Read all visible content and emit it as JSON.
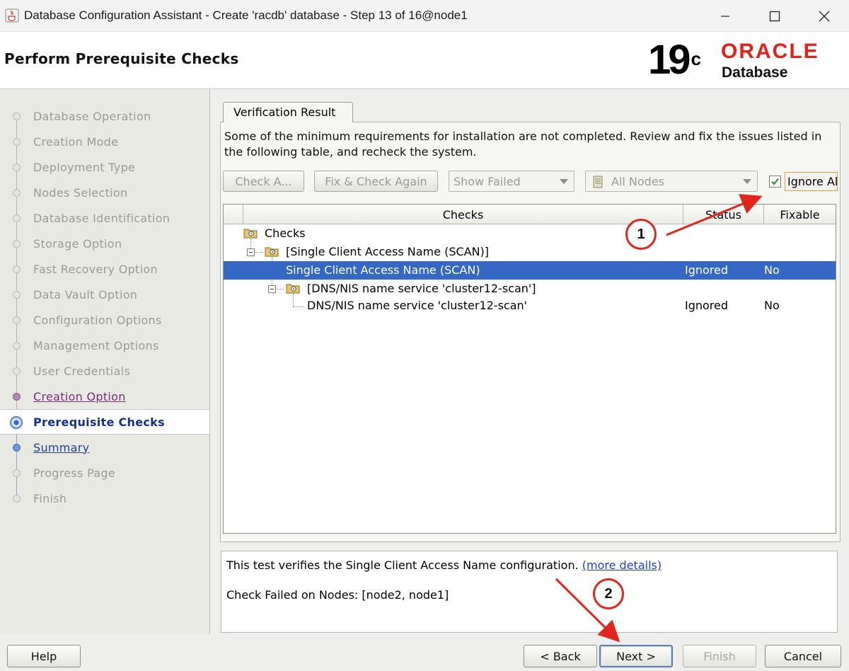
{
  "window": {
    "title": "Database Configuration Assistant - Create 'racdb' database - Step 13 of 16@node1"
  },
  "header": {
    "page_title": "Perform Prerequisite Checks",
    "logo_version": "19",
    "logo_version_sup": "c",
    "logo_brand": "ORACLE",
    "logo_product": "Database",
    "brand_color": "#e2221a"
  },
  "nav": {
    "items": [
      {
        "label": "Database Operation",
        "state": "disabled"
      },
      {
        "label": "Creation Mode",
        "state": "disabled"
      },
      {
        "label": "Deployment Type",
        "state": "disabled"
      },
      {
        "label": "Nodes Selection",
        "state": "disabled"
      },
      {
        "label": "Database Identification",
        "state": "disabled"
      },
      {
        "label": "Storage Option",
        "state": "disabled"
      },
      {
        "label": "Fast Recovery Option",
        "state": "disabled"
      },
      {
        "label": "Data Vault Option",
        "state": "disabled"
      },
      {
        "label": "Configuration Options",
        "state": "disabled"
      },
      {
        "label": "Management Options",
        "state": "disabled"
      },
      {
        "label": "User Credentials",
        "state": "disabled"
      },
      {
        "label": "Creation Option",
        "state": "visited"
      },
      {
        "label": "Prerequisite Checks",
        "state": "current"
      },
      {
        "label": "Summary",
        "state": "link"
      },
      {
        "label": "Progress Page",
        "state": "disabled"
      },
      {
        "label": "Finish",
        "state": "disabled"
      }
    ]
  },
  "main": {
    "tab_label": "Verification Result",
    "description": "Some of the minimum requirements for installation are not completed. Review and fix the issues listed in the following table, and recheck the system.",
    "toolbar": {
      "check_again": "Check A...",
      "fix_check_again": "Fix & Check Again",
      "filter_selected": "Show Failed",
      "nodes_selected": "All Nodes",
      "ignore_all": "Ignore All",
      "ignore_all_checked": true
    },
    "table": {
      "columns": [
        "Checks",
        "Status",
        "Fixable"
      ],
      "rows": [
        {
          "label": "Checks",
          "status": "",
          "fixable": ""
        },
        {
          "label": "[Single Client Access Name (SCAN)]",
          "status": "",
          "fixable": ""
        },
        {
          "label": "Single Client Access Name (SCAN)",
          "status": "Ignored",
          "fixable": "No"
        },
        {
          "label": "[DNS/NIS name service 'cluster12-scan']",
          "status": "",
          "fixable": ""
        },
        {
          "label": "DNS/NIS name service 'cluster12-scan'",
          "status": "Ignored",
          "fixable": "No"
        }
      ]
    },
    "details": {
      "text": "This test verifies the Single Client Access Name configuration.",
      "link": "(more details)",
      "failed_nodes": "Check Failed on Nodes: [node2, node1]"
    }
  },
  "footer": {
    "help": "Help",
    "back": "< Back",
    "next": "Next >",
    "finish": "Finish",
    "cancel": "Cancel"
  },
  "annotations": {
    "callout_1": "1",
    "callout_2": "2",
    "color": "#e2261e"
  }
}
